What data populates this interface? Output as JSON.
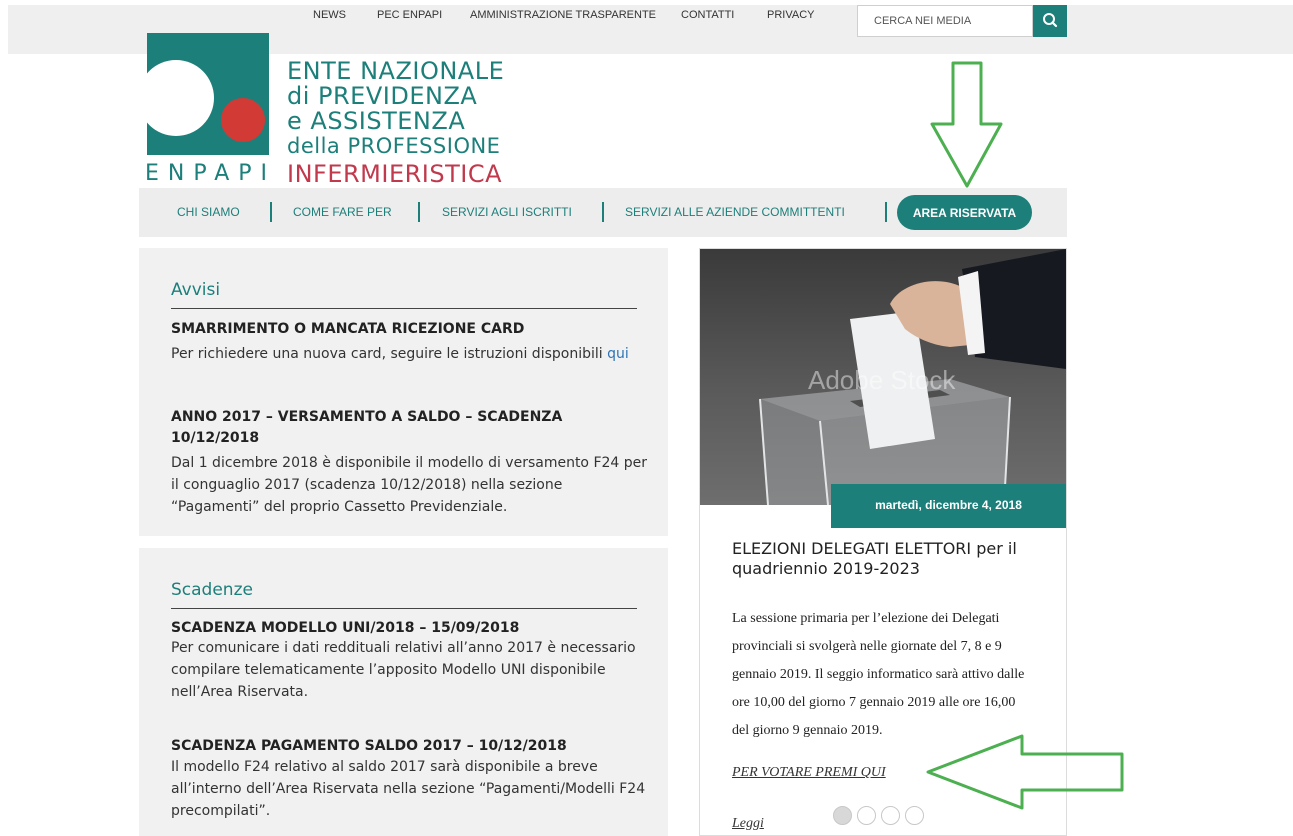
{
  "topnav": {
    "items": [
      "NEWS",
      "PEC ENPAPI",
      "AMMINISTRAZIONE TRASPARENTE",
      "CONTATTI",
      "PRIVACY"
    ],
    "search_placeholder": "CERCA NEI MEDIA"
  },
  "logo": {
    "lines": [
      "ENTE NAZIONALE",
      "di PREVIDENZA",
      "e ASSISTENZA",
      "della PROFESSIONE"
    ],
    "acronym": "ENPAPI",
    "last_line": "INFERMIERISTICA"
  },
  "mainnav": {
    "items": [
      "CHI SIAMO",
      "COME FARE PER",
      "SERVIZI AGLI ISCRITTI",
      "SERVIZI ALLE AZIENDE COMMITTENTI"
    ],
    "area_button": "AREA RISERVATA"
  },
  "avvisi": {
    "title": "Avvisi",
    "item1_title": "SMARRIMENTO O MANCATA RICEZIONE CARD",
    "item1_text": "Per richiedere una nuova card, seguire le istruzioni disponibili",
    "item1_link": "qui",
    "item2_title": "ANNO 2017 – VERSAMENTO A SALDO – SCADENZA 10/12/2018",
    "item2_text": "Dal 1 dicembre 2018 è disponibile il modello di versamento F24 per il conguaglio 2017 (scadenza 10/12/2018) nella sezione “Pagamenti” del proprio Cassetto Previdenziale."
  },
  "scadenze": {
    "title": "Scadenze",
    "item1_title": "SCADENZA MODELLO UNI/2018 – 15/09/2018",
    "item1_text": "Per comunicare i dati reddituali relativi all’anno 2017 è necessario compilare telematicamente l’apposito Modello UNI disponibile nell’Area Riservata.",
    "item2_title": "SCADENZA PAGAMENTO SALDO 2017 – 10/12/2018",
    "item2_text": "Il modello F24 relativo al saldo 2017 sarà disponibile a breve all’interno dell’Area Riservata nella sezione “Pagamenti/Modelli F24 precompilati”."
  },
  "news_card": {
    "watermark": "Adobe Stock",
    "date": "martedì, dicembre 4, 2018",
    "title": "ELEZIONI DELEGATI ELETTORI per il quadriennio 2019-2023",
    "text": "La sessione primaria per l’elezione dei Delegati provinciali si svolgerà nelle giornate del 7, 8 e 9 gennaio 2019. Il seggio informatico sarà attivo dalle ore 10,00 del giorno 7 gennaio 2019 alle ore 16,00 del giorno 9 gennaio 2019.",
    "vote_link": "PER VOTARE PREMI QUI",
    "read_more": "Leggi",
    "slides_total": 4,
    "slide_active": 1
  },
  "colors": {
    "brand_teal": "#1d7f7a",
    "logo_red": "#d23a35",
    "arrow_green": "#4caf50"
  }
}
